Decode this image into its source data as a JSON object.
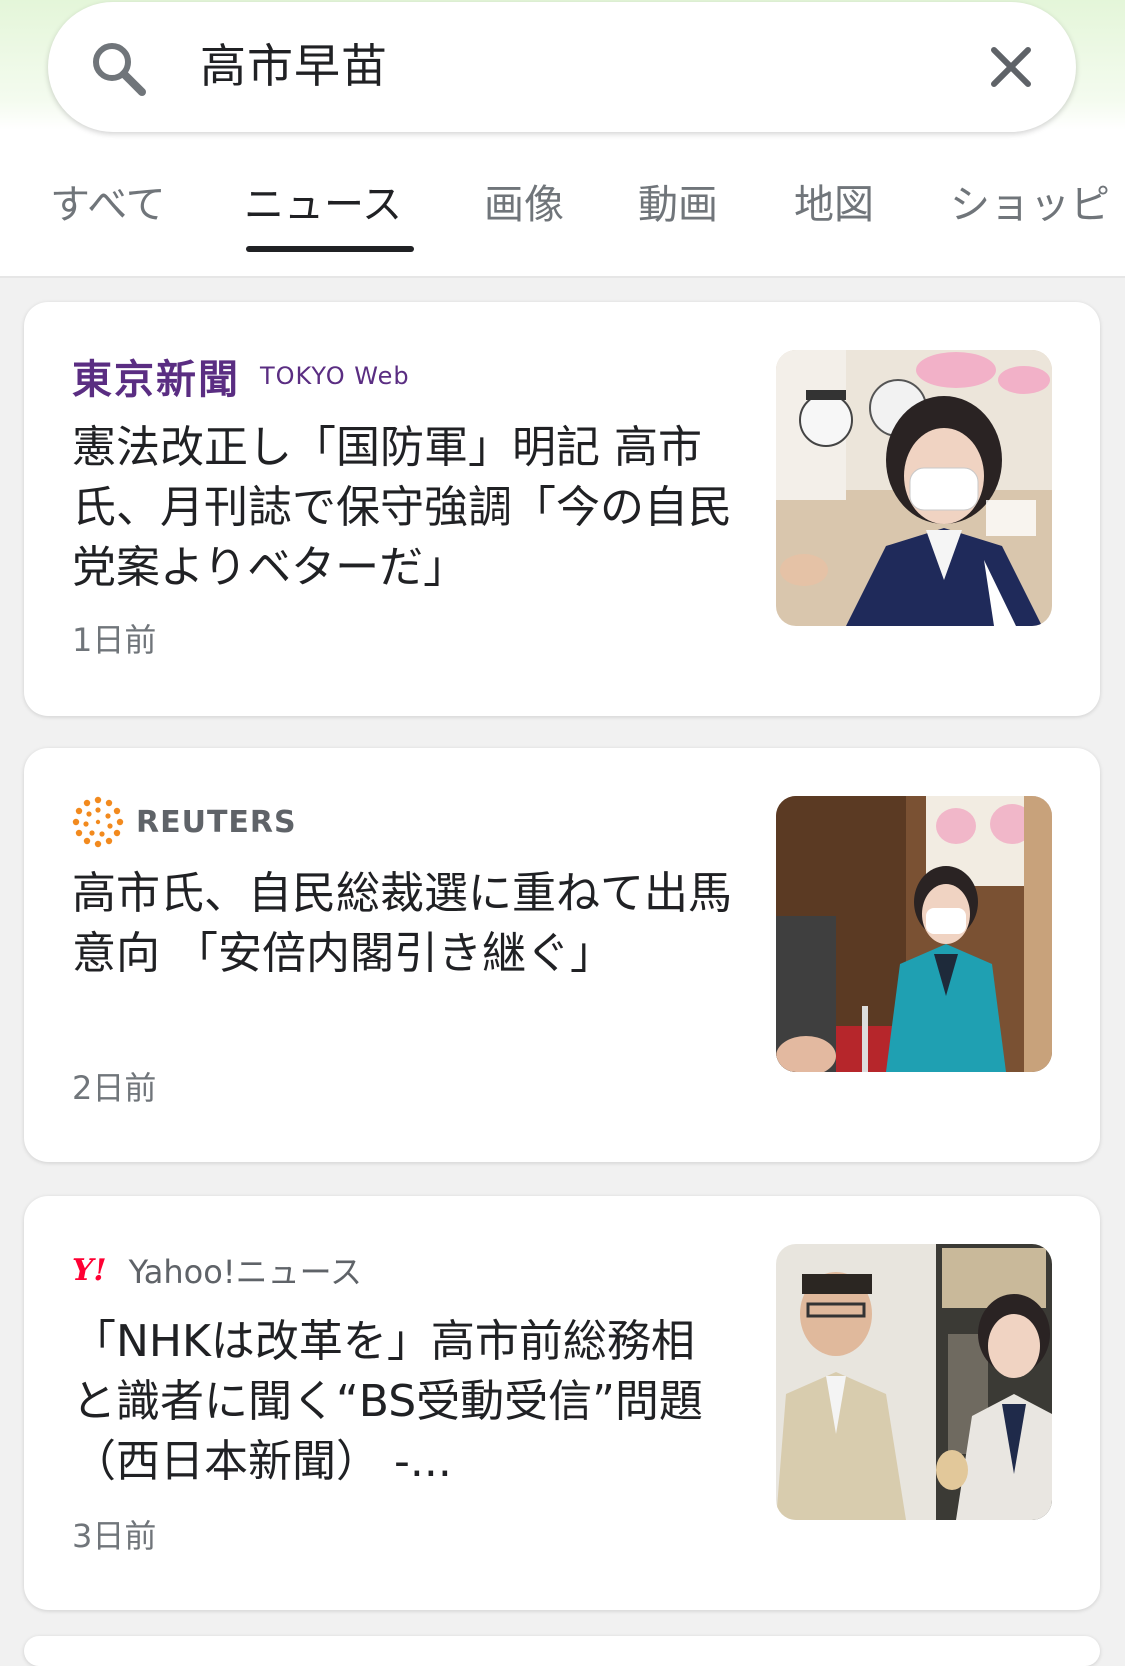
{
  "search": {
    "query": "高市早苗"
  },
  "tabs": [
    {
      "label": "すべて",
      "active": false
    },
    {
      "label": "ニュース",
      "active": true
    },
    {
      "label": "画像",
      "active": false
    },
    {
      "label": "動画",
      "active": false
    },
    {
      "label": "地図",
      "active": false
    },
    {
      "label": "ショッピ",
      "active": false
    }
  ],
  "articles": [
    {
      "source_logo_jp": "東京新聞",
      "source_logo_en": "TOKYO Web",
      "headline": "憲法改正し「国防軍」明記 高市氏、月刊誌で保守強調「今の自民党案よりベターだ」",
      "time": "1日前"
    },
    {
      "source_logo": "REUTERS",
      "headline": "高市氏、自民総裁選に重ねて出馬意向 「安倍内閣引き継ぐ」",
      "time": "2日前"
    },
    {
      "source_logo_mark": "Y!",
      "source_name": "Yahoo!ニュース",
      "headline": "「NHKは改革を」高市前総務相と識者に聞く“BS受動受信”問題（西日本新聞） -...",
      "time": "3日前"
    }
  ],
  "colors": {
    "accent_green": "#e4f6d9",
    "tokyo_purple": "#5a2d82",
    "reuters_orange": "#f28a1e",
    "yahoo_red": "#ff0033"
  }
}
